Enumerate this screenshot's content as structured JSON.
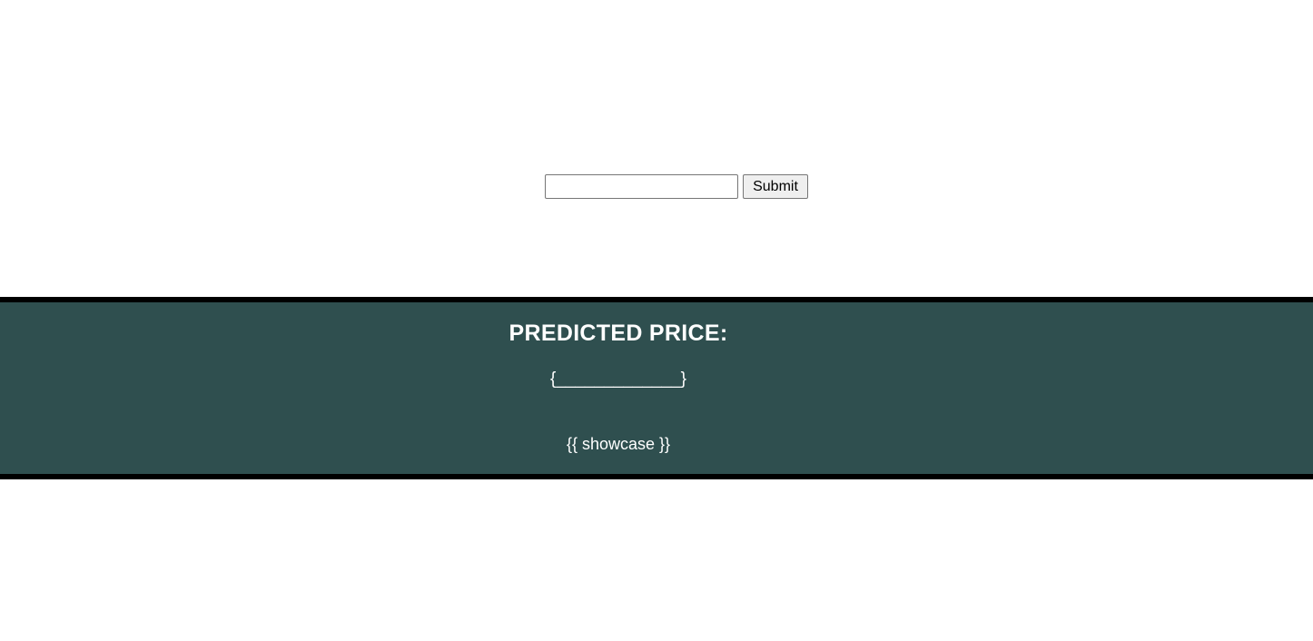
{
  "form": {
    "input_value": "",
    "input_placeholder": "",
    "submit_label": "Submit"
  },
  "result": {
    "title": "PREDICTED PRICE:",
    "value": "{_____________}",
    "showcase": "{{ showcase }}"
  },
  "colors": {
    "band_background": "#2f4f4f",
    "band_border": "#000000",
    "text": "#ffffff"
  }
}
